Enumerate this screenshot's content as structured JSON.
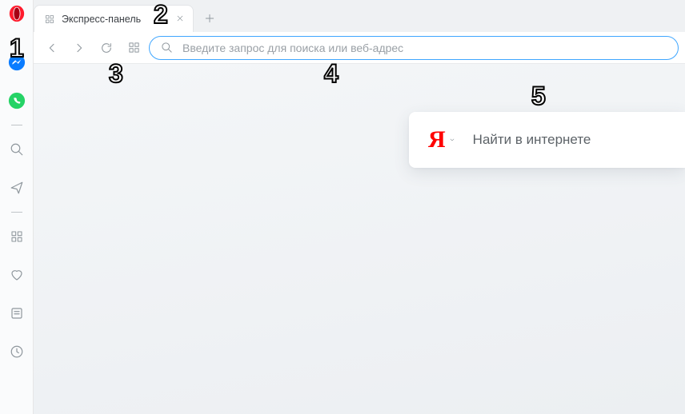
{
  "tab": {
    "title": "Экспресс-панель"
  },
  "addressbar": {
    "placeholder": "Введите запрос для поиска или веб-адрес",
    "value": ""
  },
  "speeddial": {
    "search": {
      "provider": "Я",
      "placeholder": "Найти в интернете"
    }
  },
  "sidebar": {
    "items": [
      {
        "id": "messenger"
      },
      {
        "id": "whatsapp"
      },
      {
        "id": "search"
      },
      {
        "id": "flow"
      },
      {
        "id": "speeddial"
      },
      {
        "id": "bookmarks"
      },
      {
        "id": "news"
      },
      {
        "id": "history"
      }
    ]
  },
  "annotations": {
    "1": "1",
    "2": "2",
    "3": "3",
    "4": "4",
    "5": "5"
  }
}
